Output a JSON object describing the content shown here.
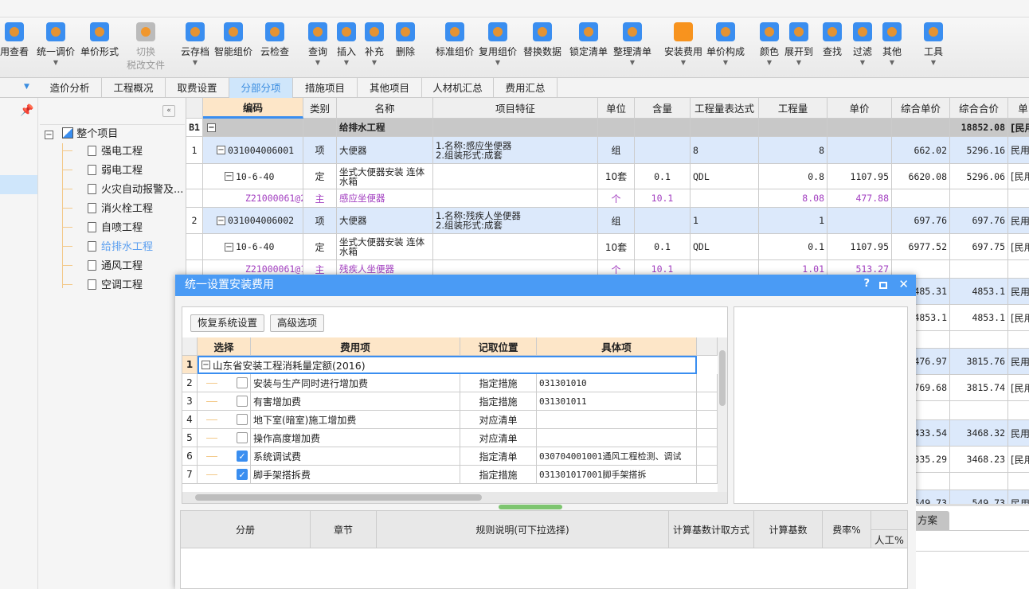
{
  "toolbar": [
    {
      "label": "用查看"
    },
    {
      "label": "统一调价",
      "arrow": true
    },
    {
      "label": "单价形式"
    },
    {
      "label": "切换",
      "label2": "税改文件",
      "disabled": true
    },
    {
      "label": "云存档",
      "arrow": true
    },
    {
      "label": "智能组价"
    },
    {
      "label": "云检查"
    },
    {
      "label": "查询",
      "arrow": true
    },
    {
      "label": "插入",
      "arrow": true
    },
    {
      "label": "补充",
      "arrow": true
    },
    {
      "label": "删除"
    },
    {
      "label": "标准组价"
    },
    {
      "label": "复用组价",
      "arrow": true
    },
    {
      "label": "替换数据"
    },
    {
      "label": "锁定清单"
    },
    {
      "label": "整理清单",
      "arrow": true
    },
    {
      "label": "安装费用",
      "arrow": true
    },
    {
      "label": "单价构成",
      "arrow": true
    },
    {
      "label": "颜色",
      "arrow": true
    },
    {
      "label": "展开到",
      "arrow": true
    },
    {
      "label": "查找"
    },
    {
      "label": "过滤",
      "arrow": true
    },
    {
      "label": "其他",
      "arrow": true
    },
    {
      "label": "工具",
      "arrow": true
    }
  ],
  "tabs": [
    "造价分析",
    "工程概况",
    "取费设置",
    "分部分项",
    "措施项目",
    "其他项目",
    "人材机汇总",
    "费用汇总"
  ],
  "active_tab": "分部分项",
  "tree": {
    "root": "整个项目",
    "items": [
      "强电工程",
      "弱电工程",
      "火灾自动报警及...",
      "消火栓工程",
      "自喷工程",
      "给排水工程",
      "通风工程",
      "空调工程"
    ],
    "selected": "给排水工程"
  },
  "grid": {
    "headers": [
      "编码",
      "类别",
      "名称",
      "项目特征",
      "单位",
      "含量",
      "工程量表达式",
      "工程量",
      "单价",
      "综合单价",
      "综合合价",
      "单"
    ],
    "rows": [
      {
        "no": "B1",
        "code": "",
        "type": "",
        "name": "给排水工程",
        "feature": "",
        "unit": "",
        "qty_ratio": "",
        "expr": "",
        "qty": "",
        "price": "",
        "comp_price": "",
        "comp_total": "18852.08",
        "extra": "[民用"
      },
      {
        "no": "1",
        "code": "031004006001",
        "type": "项",
        "name": "大便器",
        "feature": "1.名称:感应坐便器\n2.组装形式:成套",
        "unit": "组",
        "qty_ratio": "",
        "expr": "8",
        "qty": "8",
        "price": "",
        "comp_price": "662.02",
        "comp_total": "5296.16",
        "extra": "民用"
      },
      {
        "no": "",
        "code": "10-6-40",
        "type": "定",
        "name": "坐式大便器安装 连体水箱",
        "feature": "",
        "unit": "10套",
        "qty_ratio": "0.1",
        "expr": "QDL",
        "qty": "0.8",
        "price": "1107.95",
        "comp_price": "6620.08",
        "comp_total": "5296.06",
        "extra": "[民用"
      },
      {
        "no": "",
        "code": "Z21000061@2",
        "type": "主",
        "name": "感应坐便器",
        "feature": "",
        "unit": "个",
        "qty_ratio": "10.1",
        "expr": "",
        "qty": "8.08",
        "price": "477.88",
        "comp_price": "",
        "comp_total": "",
        "extra": ""
      },
      {
        "no": "2",
        "code": "031004006002",
        "type": "项",
        "name": "大便器",
        "feature": "1.名称:残疾人坐便器\n2.组装形式:成套",
        "unit": "组",
        "qty_ratio": "",
        "expr": "1",
        "qty": "1",
        "price": "",
        "comp_price": "697.76",
        "comp_total": "697.76",
        "extra": "民用"
      },
      {
        "no": "",
        "code": "10-6-40",
        "type": "定",
        "name": "坐式大便器安装 连体水箱",
        "feature": "",
        "unit": "10套",
        "qty_ratio": "0.1",
        "expr": "QDL",
        "qty": "0.1",
        "price": "1107.95",
        "comp_price": "6977.52",
        "comp_total": "697.75",
        "extra": "[民用"
      },
      {
        "no": "",
        "code": "Z21000061@1",
        "type": "主",
        "name": "残疾人坐便器",
        "feature": "",
        "unit": "个",
        "qty_ratio": "10.1",
        "expr": "",
        "qty": "1.01",
        "price": "513.27",
        "comp_price": "",
        "comp_total": "",
        "extra": ""
      },
      {
        "comp_price": "485.31",
        "comp_total": "4853.1",
        "extra": "民用"
      },
      {
        "comp_price": "4853.1",
        "comp_total": "4853.1",
        "extra": "[民用"
      },
      {
        "comp_price": "",
        "comp_total": "",
        "extra": ""
      },
      {
        "comp_price": "476.97",
        "comp_total": "3815.76",
        "extra": "民用"
      },
      {
        "comp_price": "4769.68",
        "comp_total": "3815.74",
        "extra": "[民用"
      },
      {
        "comp_price": "",
        "comp_total": "",
        "extra": ""
      },
      {
        "comp_price": "433.54",
        "comp_total": "3468.32",
        "extra": "民用"
      },
      {
        "comp_price": "4335.29",
        "comp_total": "3468.23",
        "extra": "[民用"
      },
      {
        "comp_price": "",
        "comp_total": "",
        "extra": ""
      },
      {
        "comp_price": "549.73",
        "comp_total": "549.73",
        "extra": "民用"
      }
    ]
  },
  "bottom_tab": "方案",
  "dialog": {
    "title": "统一设置安装费用",
    "buttons": {
      "restore": "恢复系统设置",
      "advanced": "高级选项"
    },
    "headers": [
      "选择",
      "费用项",
      "记取位置",
      "具体项"
    ],
    "rows": [
      {
        "no": "1",
        "name": "山东省安装工程消耗量定额(2016)",
        "group": true
      },
      {
        "no": "2",
        "checked": false,
        "name": "安装与生产同时进行增加费",
        "pos": "指定措施",
        "item": "031301010"
      },
      {
        "no": "3",
        "checked": false,
        "name": "有害增加费",
        "pos": "指定措施",
        "item": "031301011"
      },
      {
        "no": "4",
        "checked": false,
        "name": "地下室(暗室)施工增加费",
        "pos": "对应清单",
        "item": ""
      },
      {
        "no": "5",
        "checked": false,
        "name": "操作高度增加费",
        "pos": "对应清单",
        "item": ""
      },
      {
        "no": "6",
        "checked": true,
        "name": "系统调试费",
        "pos": "指定清单",
        "item": "030704001001通风工程检测、调试"
      },
      {
        "no": "7",
        "checked": true,
        "name": "脚手架搭拆费",
        "pos": "指定措施",
        "item": "031301017001脚手架搭拆"
      }
    ],
    "bottom_headers": [
      "分册",
      "章节",
      "规则说明(可下拉选择)",
      "计算基数计取方式",
      "计算基数",
      "费率%",
      "人工%"
    ]
  },
  "colors": {
    "accent": "#4a9bf5",
    "header_orange": "#fde6c8",
    "row_blue": "#dce9fb",
    "main_material": "#a23ec0"
  }
}
